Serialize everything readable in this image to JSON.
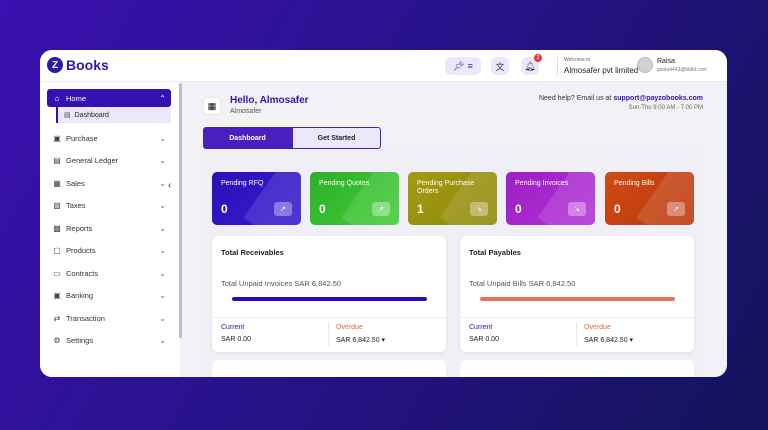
{
  "app": {
    "logo_letter": "Z",
    "name": "Books"
  },
  "topbar": {
    "welcome_label": "Welcome to",
    "company": "Almosafer pvt limited",
    "user_name": "Raisa",
    "user_email": "gsata4443@bbibl.com",
    "notification_count": "2"
  },
  "sidebar": {
    "home": "Home",
    "dashboard": "Dashboard",
    "items": [
      {
        "label": "Purchase",
        "icon": "cart-icon"
      },
      {
        "label": "General Ledger",
        "icon": "ledger-icon"
      },
      {
        "label": "Sales",
        "icon": "sales-icon"
      },
      {
        "label": "Taxes",
        "icon": "tax-icon"
      },
      {
        "label": "Reports",
        "icon": "reports-icon"
      },
      {
        "label": "Products",
        "icon": "products-icon"
      },
      {
        "label": "Contracts",
        "icon": "contracts-icon"
      },
      {
        "label": "Banking",
        "icon": "bank-icon"
      },
      {
        "label": "Transaction",
        "icon": "transaction-icon"
      },
      {
        "label": "Settings",
        "icon": "settings-icon"
      }
    ]
  },
  "greeting": {
    "title": "Hello, Almosafer",
    "subtitle": "Almosafer"
  },
  "help": {
    "text": "Need help? Email us at",
    "email": "support@payzobooks.com",
    "hours": "Sun-Thu 9.00 AM - 7.00 PM"
  },
  "tabs": {
    "dashboard": "Dashboard",
    "get_started": "Get Started"
  },
  "cards": [
    {
      "title": "Pending RFQ",
      "value": "0",
      "color": "#2b10b8"
    },
    {
      "title": "Pending Quotes",
      "value": "0",
      "color": "#2fae2a"
    },
    {
      "title": "Pending Purchase Orders",
      "value": "1",
      "color": "#a39a12"
    },
    {
      "title": "Pending Invoices",
      "value": "0",
      "color": "#9c1fc4"
    },
    {
      "title": "Pending Bills",
      "value": "0",
      "color": "#d24a14"
    }
  ],
  "receivables": {
    "title": "Total Receivables",
    "unpaid": "Total Unpaid Invoices SAR 6,842.50",
    "bar_color": "#2b10b8",
    "current_label": "Current",
    "current_value": "SAR 0.00",
    "overdue_label": "Overdue",
    "overdue_value": "SAR 6,842.50"
  },
  "payables": {
    "title": "Total Payables",
    "unpaid": "Total Unpaid Bills SAR 6,842.50",
    "bar_color": "#e8735a",
    "current_label": "Current",
    "current_value": "SAR 0.00",
    "overdue_label": "Overdue",
    "overdue_value": "SAR 6,842.50"
  }
}
